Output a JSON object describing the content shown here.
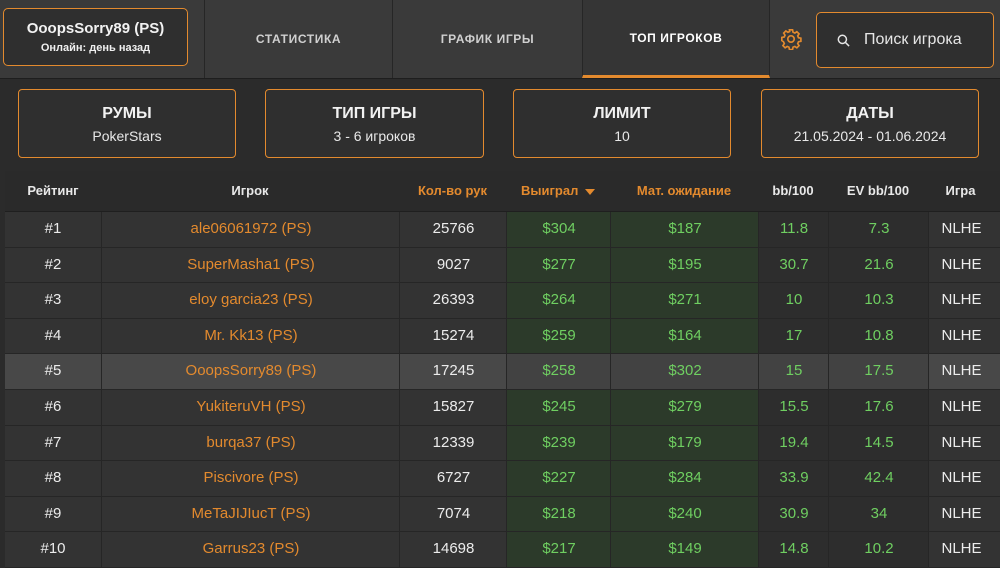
{
  "profile": {
    "name": "OoopsSorry89 (PS)",
    "status": "Онлайн: день назад"
  },
  "nav": {
    "tabs": [
      {
        "label": "СТАТИСТИКА"
      },
      {
        "label": "ГРАФИК ИГРЫ"
      },
      {
        "label": "ТОП ИГРОКОВ"
      }
    ],
    "active_tab": "ТОП ИГРОКОВ"
  },
  "search": {
    "placeholder": "Поиск игрока",
    "value": ""
  },
  "filters": [
    {
      "title": "РУМЫ",
      "value": "PokerStars"
    },
    {
      "title": "ТИП ИГРЫ",
      "value": "3 - 6 игроков"
    },
    {
      "title": "ЛИМИТ",
      "value": "10"
    },
    {
      "title": "ДАТЫ",
      "value": "21.05.2024 - 01.06.2024"
    }
  ],
  "table": {
    "headers": {
      "rank": "Рейтинг",
      "player": "Игрок",
      "hands": "Кол-во рук",
      "won": "Выиграл",
      "ev": "Мат. ожидание",
      "bb": "bb/100",
      "evbb": "EV bb/100",
      "game": "Игра"
    },
    "sorted_by": "Выиграл",
    "rows": [
      {
        "rank": "#1",
        "player": "ale06061972 (PS)",
        "hands": "25766",
        "won": "$304",
        "ev": "$187",
        "bb": "11.8",
        "evbb": "7.3",
        "game": "NLHE"
      },
      {
        "rank": "#2",
        "player": "SuperMasha1 (PS)",
        "hands": "9027",
        "won": "$277",
        "ev": "$195",
        "bb": "30.7",
        "evbb": "21.6",
        "game": "NLHE"
      },
      {
        "rank": "#3",
        "player": "eloy garcia23 (PS)",
        "hands": "26393",
        "won": "$264",
        "ev": "$271",
        "bb": "10",
        "evbb": "10.3",
        "game": "NLHE"
      },
      {
        "rank": "#4",
        "player": "Mr. Kk13 (PS)",
        "hands": "15274",
        "won": "$259",
        "ev": "$164",
        "bb": "17",
        "evbb": "10.8",
        "game": "NLHE"
      },
      {
        "rank": "#5",
        "player": "OoopsSorry89 (PS)",
        "hands": "17245",
        "won": "$258",
        "ev": "$302",
        "bb": "15",
        "evbb": "17.5",
        "game": "NLHE",
        "highlight": true
      },
      {
        "rank": "#6",
        "player": "YukiteruVH (PS)",
        "hands": "15827",
        "won": "$245",
        "ev": "$279",
        "bb": "15.5",
        "evbb": "17.6",
        "game": "NLHE"
      },
      {
        "rank": "#7",
        "player": "burqa37 (PS)",
        "hands": "12339",
        "won": "$239",
        "ev": "$179",
        "bb": "19.4",
        "evbb": "14.5",
        "game": "NLHE"
      },
      {
        "rank": "#8",
        "player": "Piscivore (PS)",
        "hands": "6727",
        "won": "$227",
        "ev": "$284",
        "bb": "33.9",
        "evbb": "42.4",
        "game": "NLHE"
      },
      {
        "rank": "#9",
        "player": "MeTaJIJIucT (PS)",
        "hands": "7074",
        "won": "$218",
        "ev": "$240",
        "bb": "30.9",
        "evbb": "34",
        "game": "NLHE"
      },
      {
        "rank": "#10",
        "player": "Garrus23 (PS)",
        "hands": "14698",
        "won": "$217",
        "ev": "$149",
        "bb": "14.8",
        "evbb": "10.2",
        "game": "NLHE"
      }
    ]
  },
  "colors": {
    "accent": "#e38a2e",
    "positive": "#6fcf61",
    "background": "#2b2b2b",
    "highlight_row": "#484848"
  },
  "icons": {
    "settings": "gear-icon",
    "search": "search-icon",
    "sort": "sort-desc-icon"
  }
}
